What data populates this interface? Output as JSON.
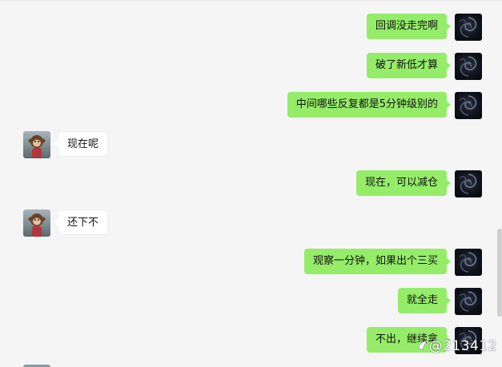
{
  "messages": [
    {
      "side": "self",
      "text": "回调没走完啊"
    },
    {
      "side": "self",
      "text": "破了新低才算"
    },
    {
      "side": "self",
      "text": "中间哪些反复都是5分钟级别的"
    },
    {
      "side": "other",
      "text": "现在呢"
    },
    {
      "side": "self",
      "text": "现在，可以减仓"
    },
    {
      "side": "other",
      "text": "还下不"
    },
    {
      "side": "self",
      "text": "观察一分钟，如果出个三买"
    },
    {
      "side": "self",
      "text": "就全走"
    },
    {
      "side": "self",
      "text": "不出，继续拿"
    }
  ],
  "watermark": "@213412",
  "colors": {
    "background": "#f5f5f5",
    "self_bubble": "#95ec69",
    "other_bubble": "#ffffff"
  },
  "icons": {
    "self_avatar": "dark-swirl-avatar",
    "other_avatar": "monkey-doll-avatar",
    "watermark_logo": "platform-logo-icon"
  }
}
